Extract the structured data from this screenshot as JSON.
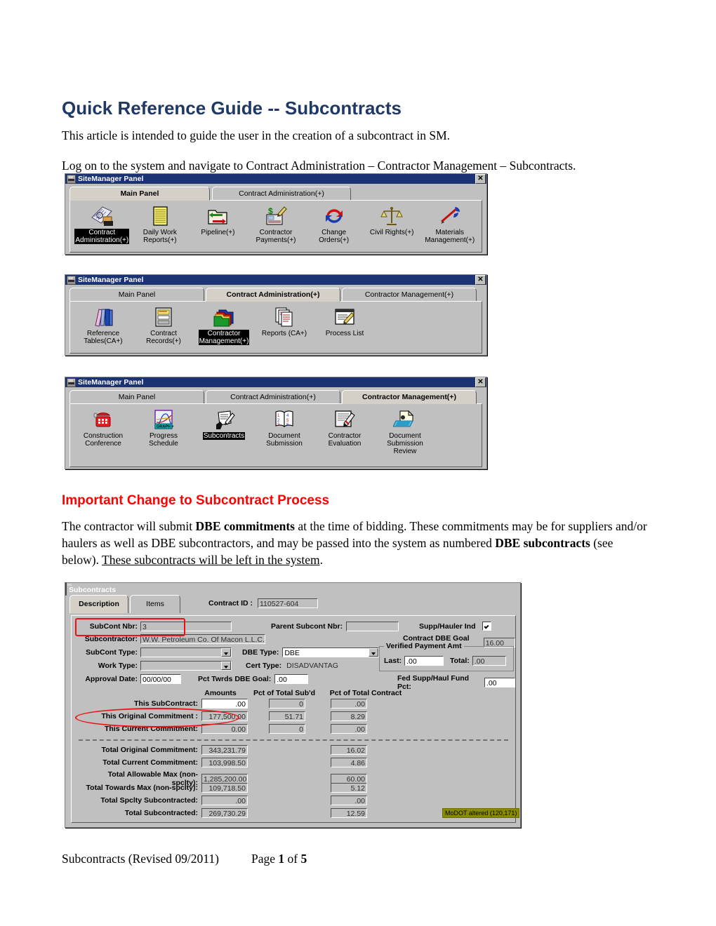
{
  "document": {
    "title": "Quick Reference Guide -- Subcontracts",
    "intro": "This article is intended to guide the user in the creation of a subcontract in SM.",
    "logon": "Log on to the system and navigate to Contract Administration – Contractor Management – Subcontracts.",
    "section_heading": "Important Change to Subcontract Process",
    "body_1": "The contractor will submit ",
    "body_bold_1": "DBE commitments",
    "body_2": " at the time of bidding.  These commitments may be for suppliers and/or haulers as well as DBE subcontractors, and may be passed into the system as numbered ",
    "body_bold_2": "DBE subcontracts",
    "body_3": " (see below).  ",
    "body_underline": "These subcontracts will be left in the system",
    "body_4": ".",
    "footer_left": "Subcontracts (Revised 09/2011)",
    "footer_page_label": "Page ",
    "footer_page_number": "1",
    "footer_of": " of ",
    "footer_page_total": "5"
  },
  "colors": {
    "title_blue": "#1F3864",
    "heading_red": "#FF0000",
    "titlebar_blue": "#1B3273",
    "window_gray": "#c0c0c0",
    "highlight_red": "#ee1111",
    "badge_olive": "#8a8a00"
  },
  "panel1": {
    "window_title": "SiteManager Panel",
    "close_label": "✕",
    "tabs": [
      {
        "label": "Main Panel",
        "selected": true
      },
      {
        "label": "Contract Administration(+)",
        "selected": false
      }
    ],
    "icons": [
      {
        "label": "Contract\nAdministration(+)",
        "icon": "contract-administration-icon",
        "highlighted": true
      },
      {
        "label": "Daily Work\nReports(+)",
        "icon": "daily-work-reports-icon",
        "highlighted": false
      },
      {
        "label": "Pipeline(+)",
        "icon": "pipeline-icon",
        "highlighted": false
      },
      {
        "label": "Contractor\nPayments(+)",
        "icon": "contractor-payments-icon",
        "highlighted": false
      },
      {
        "label": "Change\nOrders(+)",
        "icon": "change-orders-icon",
        "highlighted": false
      },
      {
        "label": "Civil Rights(+)",
        "icon": "civil-rights-icon",
        "highlighted": false
      },
      {
        "label": "Materials\nManagement(+)",
        "icon": "materials-management-icon",
        "highlighted": false
      }
    ]
  },
  "panel2": {
    "window_title": "SiteManager Panel",
    "close_label": "✕",
    "tabs": [
      {
        "label": "Main Panel",
        "selected": false
      },
      {
        "label": "Contract Administration(+)",
        "selected": true
      },
      {
        "label": "Contractor Management(+)",
        "selected": false
      }
    ],
    "icons": [
      {
        "label": "Reference\nTables(CA+)",
        "icon": "reference-tables-icon",
        "highlighted": false
      },
      {
        "label": "Contract\nRecords(+)",
        "icon": "contract-records-icon",
        "highlighted": false
      },
      {
        "label": "Contractor\nManagement(+)",
        "icon": "contractor-management-icon",
        "highlighted": true
      },
      {
        "label": "Reports (CA+)",
        "icon": "reports-icon",
        "highlighted": false
      },
      {
        "label": "Process List",
        "icon": "process-list-icon",
        "highlighted": false
      }
    ]
  },
  "panel3": {
    "window_title": "SiteManager Panel",
    "close_label": "✕",
    "tabs": [
      {
        "label": "Main Panel",
        "selected": false
      },
      {
        "label": "Contract Administration(+)",
        "selected": false
      },
      {
        "label": "Contractor Management(+)",
        "selected": true
      }
    ],
    "icons": [
      {
        "label": "Construction\nConference",
        "icon": "construction-conference-icon",
        "highlighted": false
      },
      {
        "label": "Progress\nSchedule",
        "icon": "progress-schedule-icon",
        "highlighted": false
      },
      {
        "label": "Subcontracts",
        "icon": "subcontracts-icon",
        "highlighted": true
      },
      {
        "label": "Document\nSubmission",
        "icon": "document-submission-icon",
        "highlighted": false
      },
      {
        "label": "Contractor\nEvaluation",
        "icon": "contractor-evaluation-icon",
        "highlighted": false
      },
      {
        "label": "Document\nSubmission\nReview",
        "icon": "document-submission-review-icon",
        "highlighted": false
      }
    ]
  },
  "subcontracts": {
    "window_title": "Subcontracts",
    "close_label": "✕",
    "tabs": [
      {
        "label": "Description",
        "selected": true
      },
      {
        "label": "Items",
        "selected": false
      }
    ],
    "contract_id_label": "Contract ID  :",
    "contract_id_value": "110527-604",
    "fields": {
      "subcont_nbr_label": "SubCont Nbr:",
      "subcont_nbr_value": "3",
      "parent_subcont_nbr_label": "Parent Subcont Nbr:",
      "parent_subcont_nbr_value": "",
      "supp_hauler_ind_label": "Supp/Hauler Ind",
      "supp_hauler_ind_checked": true,
      "subcontractor_label": "Subcontractor:",
      "subcontractor_value": "W.W. Petroleum Co. Of Macon L.L.C.",
      "contract_dbe_goal_pct_label": "Contract DBE Goal Pct:",
      "contract_dbe_goal_pct_value": "16.00",
      "subcont_type_label": "SubCont Type:",
      "subcont_type_value": "",
      "dbe_type_label": "DBE Type:",
      "dbe_type_value": "DBE",
      "work_type_label": "Work Type:",
      "work_type_value": "",
      "cert_type_label": "Cert Type:",
      "cert_type_value": "DISADVANTAG",
      "approval_date_label": "Approval Date:",
      "approval_date_value": "00/00/00",
      "pct_twrds_dbe_goal_label": "Pct Twrds DBE Goal:",
      "pct_twrds_dbe_goal_value": ".00",
      "verified_payment_group_label": "Verified Payment Amt",
      "verified_last_label": "Last:",
      "verified_last_value": ".00",
      "verified_total_label": "Total:",
      "verified_total_value": ".00",
      "fed_supp_haul_fund_pct_label": "Fed Supp/Haul Fund Pct:",
      "fed_supp_haul_fund_pct_value": ".00"
    },
    "amount_columns": [
      "Amounts",
      "Pct of Total Sub'd",
      "Pct of Total Contract"
    ],
    "amount_rows": [
      {
        "label": "This SubContract:",
        "amount": ".00",
        "pct_subd": "0",
        "pct_contract": ".00",
        "editable": true
      },
      {
        "label": "This Original Commitment :",
        "amount": "177,500.00",
        "pct_subd": "51.71",
        "pct_contract": "8.29",
        "editable": false
      },
      {
        "label": "This Current Commitment:",
        "amount": "0.00",
        "pct_subd": "0",
        "pct_contract": ".00",
        "editable": false
      }
    ],
    "total_rows": [
      {
        "label": "Total Original Commitment:",
        "amount": "343,231.79",
        "pct_contract": "16.02"
      },
      {
        "label": "Total Current Commitment:",
        "amount": "103,998.50",
        "pct_contract": "4.86"
      },
      {
        "label": "Total Allowable Max (non-spclty):",
        "amount": "1,285,200.00",
        "pct_contract": "60.00"
      },
      {
        "label": "Total Towards Max (non-spclty):",
        "amount": "109,718.50",
        "pct_contract": "5.12"
      },
      {
        "label": "Total Spclty Subcontracted:",
        "amount": ".00",
        "pct_contract": ".00"
      },
      {
        "label": "Total Subcontracted:",
        "amount": "269,730.29",
        "pct_contract": "12.59"
      }
    ],
    "badge": "MoDOT altered (120,171)"
  }
}
